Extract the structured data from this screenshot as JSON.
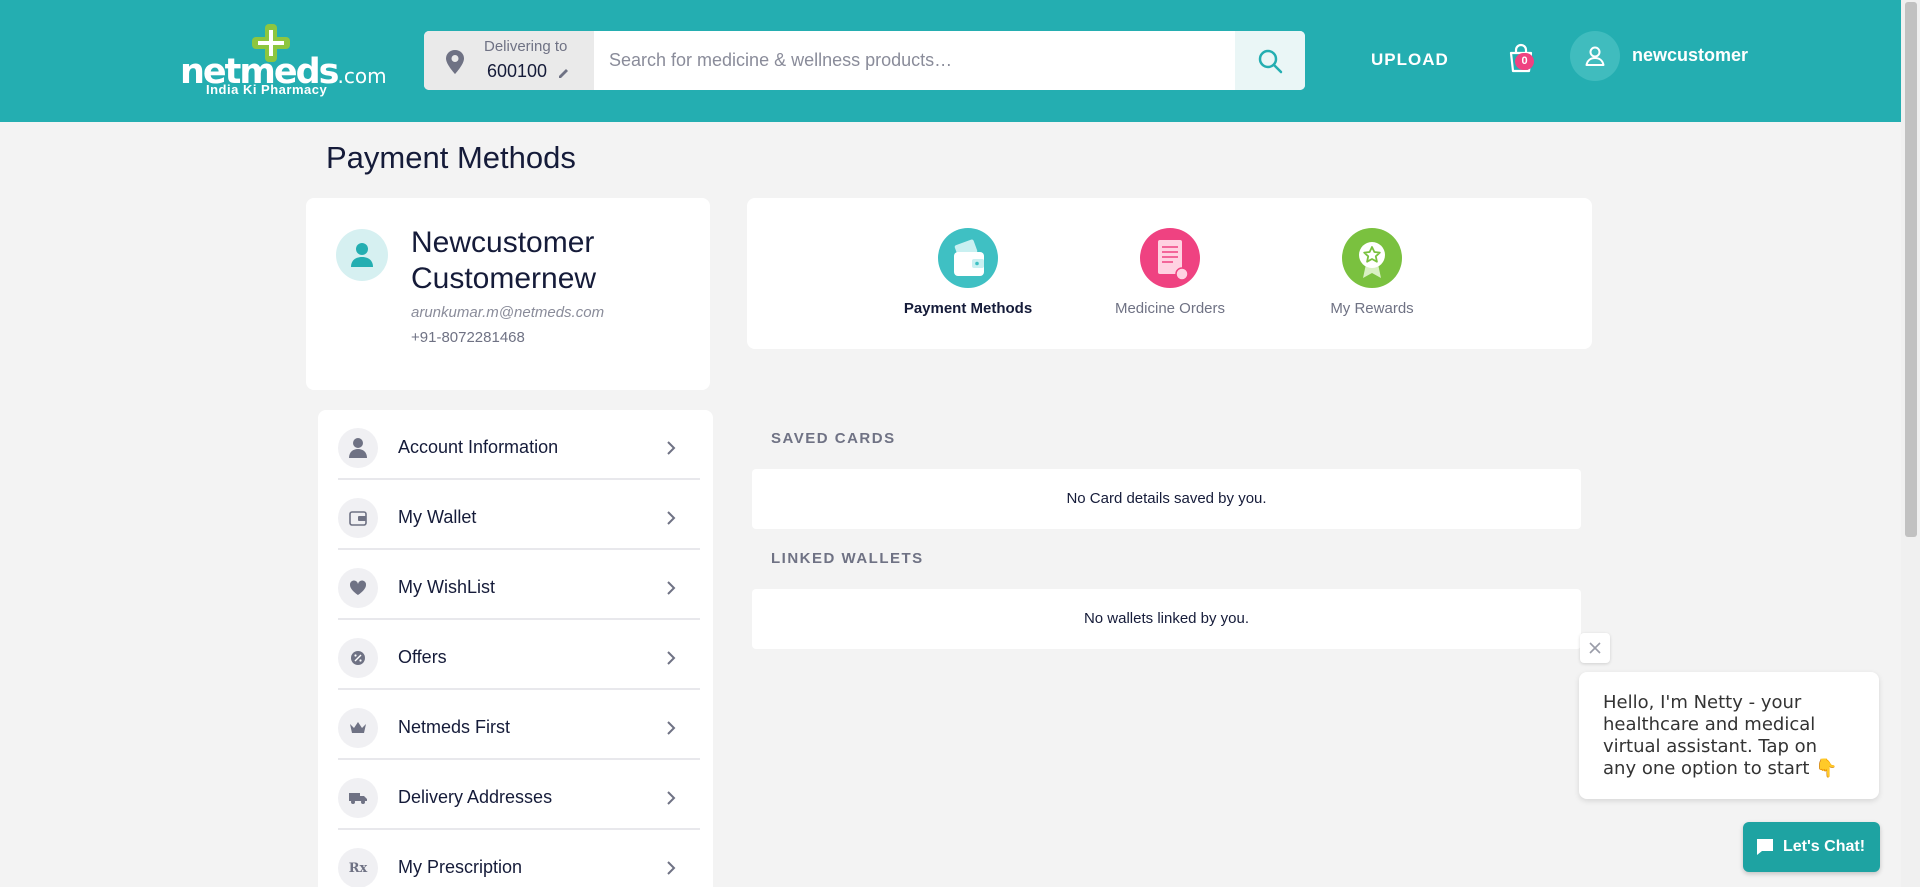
{
  "header": {
    "logo_word": "netmeds",
    "logo_suffix": ".com",
    "logo_tagline": "India Ki Pharmacy",
    "delivering_label": "Delivering to",
    "pincode": "600100",
    "search_placeholder": "Search for medicine & wellness products…",
    "upload_label": "UPLOAD",
    "cart_count": "0",
    "username": "newcustomer",
    "brand_color": "#24aeb1"
  },
  "page": {
    "title": "Payment Methods"
  },
  "profile": {
    "name": "Newcustomer Customernew",
    "email": "arunkumar.m@netmeds.com",
    "phone": "+91-8072281468"
  },
  "quick_links": [
    {
      "label": "Payment Methods",
      "icon": "wallet-icon",
      "color": "#3fc0c3",
      "active": true
    },
    {
      "label": "Medicine Orders",
      "icon": "receipt-icon",
      "color": "#ef4281",
      "active": false
    },
    {
      "label": "My Rewards",
      "icon": "rewards-star-icon",
      "color": "#7ac13f",
      "active": false
    }
  ],
  "menu": [
    {
      "label": "Account Information",
      "icon": "person-icon"
    },
    {
      "label": "My Wallet",
      "icon": "wallet-icon"
    },
    {
      "label": "My WishList",
      "icon": "heart-icon"
    },
    {
      "label": "Offers",
      "icon": "offer-percent-icon"
    },
    {
      "label": "Netmeds First",
      "icon": "crown-icon"
    },
    {
      "label": "Delivery Addresses",
      "icon": "truck-icon"
    },
    {
      "label": "My Prescription",
      "icon": "rx-icon"
    }
  ],
  "saved_cards": {
    "heading": "SAVED CARDS",
    "empty_text": "No Card details saved by you."
  },
  "linked_wallets": {
    "heading": "LINKED WALLETS",
    "empty_text": "No wallets linked by you."
  },
  "chat": {
    "message": "Hello, I'm Netty - your healthcare and medical virtual assistant. Tap on any one option to start 👇",
    "button_label": "Let's Chat!"
  }
}
